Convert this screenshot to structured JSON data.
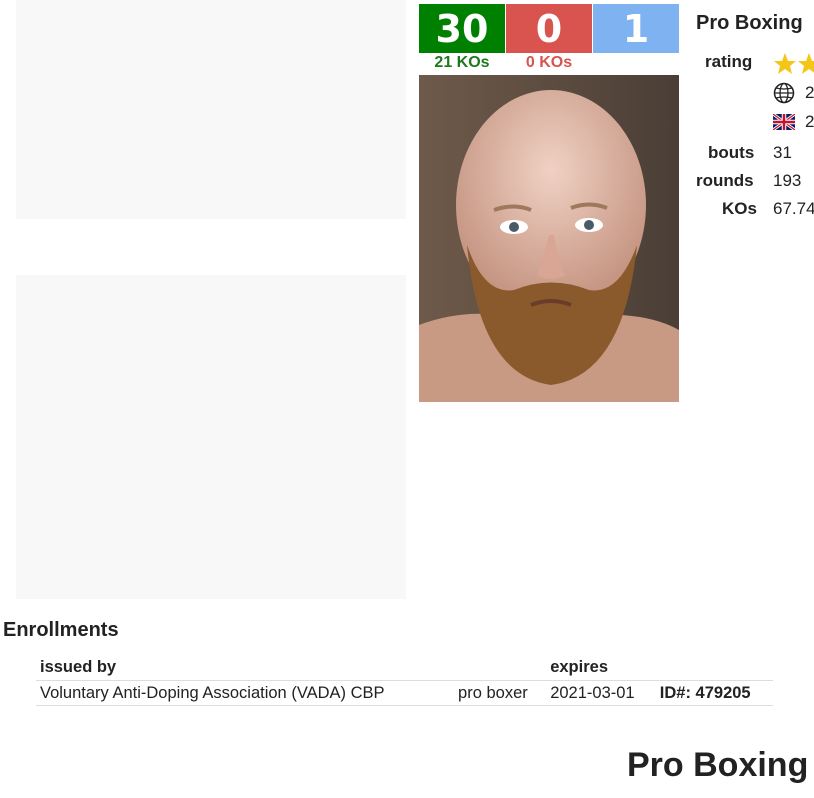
{
  "record": {
    "wins": "30",
    "losses": "0",
    "draws": "1",
    "wins_kos": "21 KOs",
    "losses_kos": "0 KOs",
    "colors": {
      "win": "#008000",
      "loss": "#d9534f",
      "draw": "#7fb2f0"
    }
  },
  "stats": {
    "heading": "Pro Boxing",
    "rating_label": "rating",
    "world_rank": "2",
    "uk_rank": "2",
    "bouts_label": "bouts",
    "bouts_value": "31",
    "rounds_label": "rounds",
    "rounds_value": "193",
    "kos_label": "KOs",
    "kos_value": "67.74"
  },
  "enrollments": {
    "title": "Enrollments",
    "headers": {
      "issued_by": "issued by",
      "expires": "expires"
    },
    "rows": [
      {
        "issuer": "Voluntary Anti-Doping Association (VADA) CBP",
        "type": "pro boxer",
        "expires": "2021-03-01",
        "id": "ID#: 479205"
      }
    ]
  },
  "bottom_heading": "Pro Boxing"
}
